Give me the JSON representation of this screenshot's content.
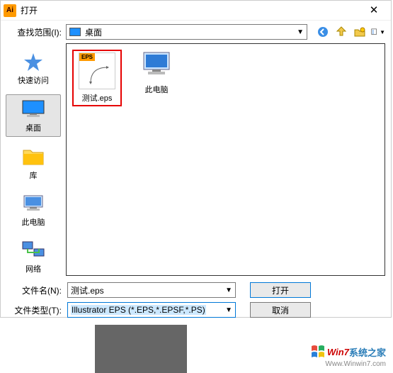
{
  "titlebar": {
    "title": "打开"
  },
  "lookin": {
    "label": "查找范围(I):",
    "location": "桌面"
  },
  "sidebar": {
    "items": [
      {
        "label": "快速访问"
      },
      {
        "label": "桌面"
      },
      {
        "label": "库"
      },
      {
        "label": "此电脑"
      },
      {
        "label": "网络"
      }
    ]
  },
  "files": {
    "items": [
      {
        "name": "测试.eps",
        "badge": "EPS"
      },
      {
        "name": "此电脑"
      }
    ]
  },
  "fields": {
    "filename_label": "文件名(N):",
    "filename_value": "测试.eps",
    "filetype_label": "文件类型(T):",
    "filetype_value": "Illustrator EPS (*.EPS,*.EPSF,*.PS)"
  },
  "buttons": {
    "open": "打开",
    "cancel": "取消"
  },
  "watermark": {
    "brand": "Win7",
    "text": "系统之家",
    "url": "Www.Winwin7.com"
  }
}
